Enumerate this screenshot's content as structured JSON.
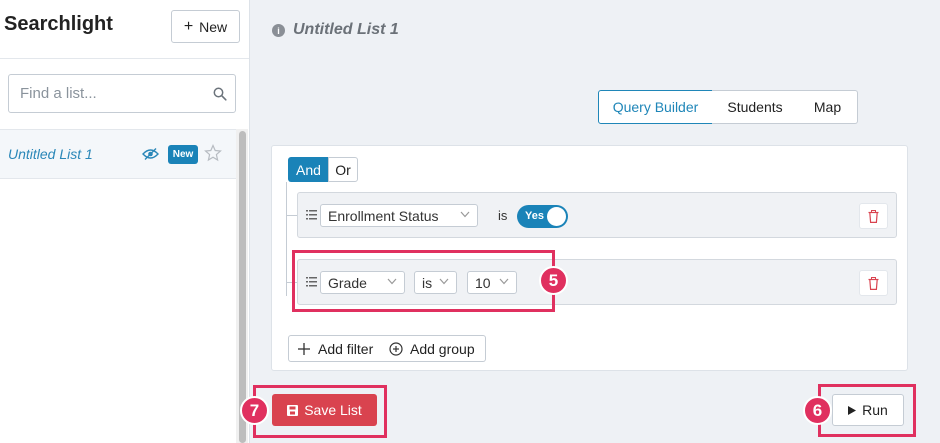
{
  "sidebar": {
    "app_title": "Searchlight",
    "new_button_label": "New",
    "search": {
      "placeholder": "Find a list...",
      "value": ""
    },
    "lists": [
      {
        "name": "Untitled List 1",
        "badge": "New",
        "icons": [
          "eye-icon",
          "star-icon"
        ]
      }
    ]
  },
  "main": {
    "list_title": "Untitled List 1",
    "info_icon_glyph": "i",
    "tabs": [
      {
        "label": "Query Builder",
        "active": true
      },
      {
        "label": "Students",
        "active": false
      },
      {
        "label": "Map",
        "active": false
      }
    ],
    "query": {
      "combinator": {
        "and_label": "And",
        "or_label": "Or",
        "selected": "And"
      },
      "rules": [
        {
          "field": "Enrollment Status",
          "operator": "is",
          "value_toggle": "Yes"
        },
        {
          "field": "Grade",
          "operator": "is",
          "value": "10"
        }
      ],
      "add_filter_label": "Add filter",
      "add_group_label": "Add group"
    },
    "save_button_label": "Save List",
    "run_button_label": "Run"
  },
  "annotations": {
    "step5": "5",
    "step6": "6",
    "step7": "7"
  },
  "colors": {
    "primary": "#1a83b8",
    "danger": "#d9434f",
    "annotation": "#e0305f",
    "background": "#eef1f5"
  }
}
